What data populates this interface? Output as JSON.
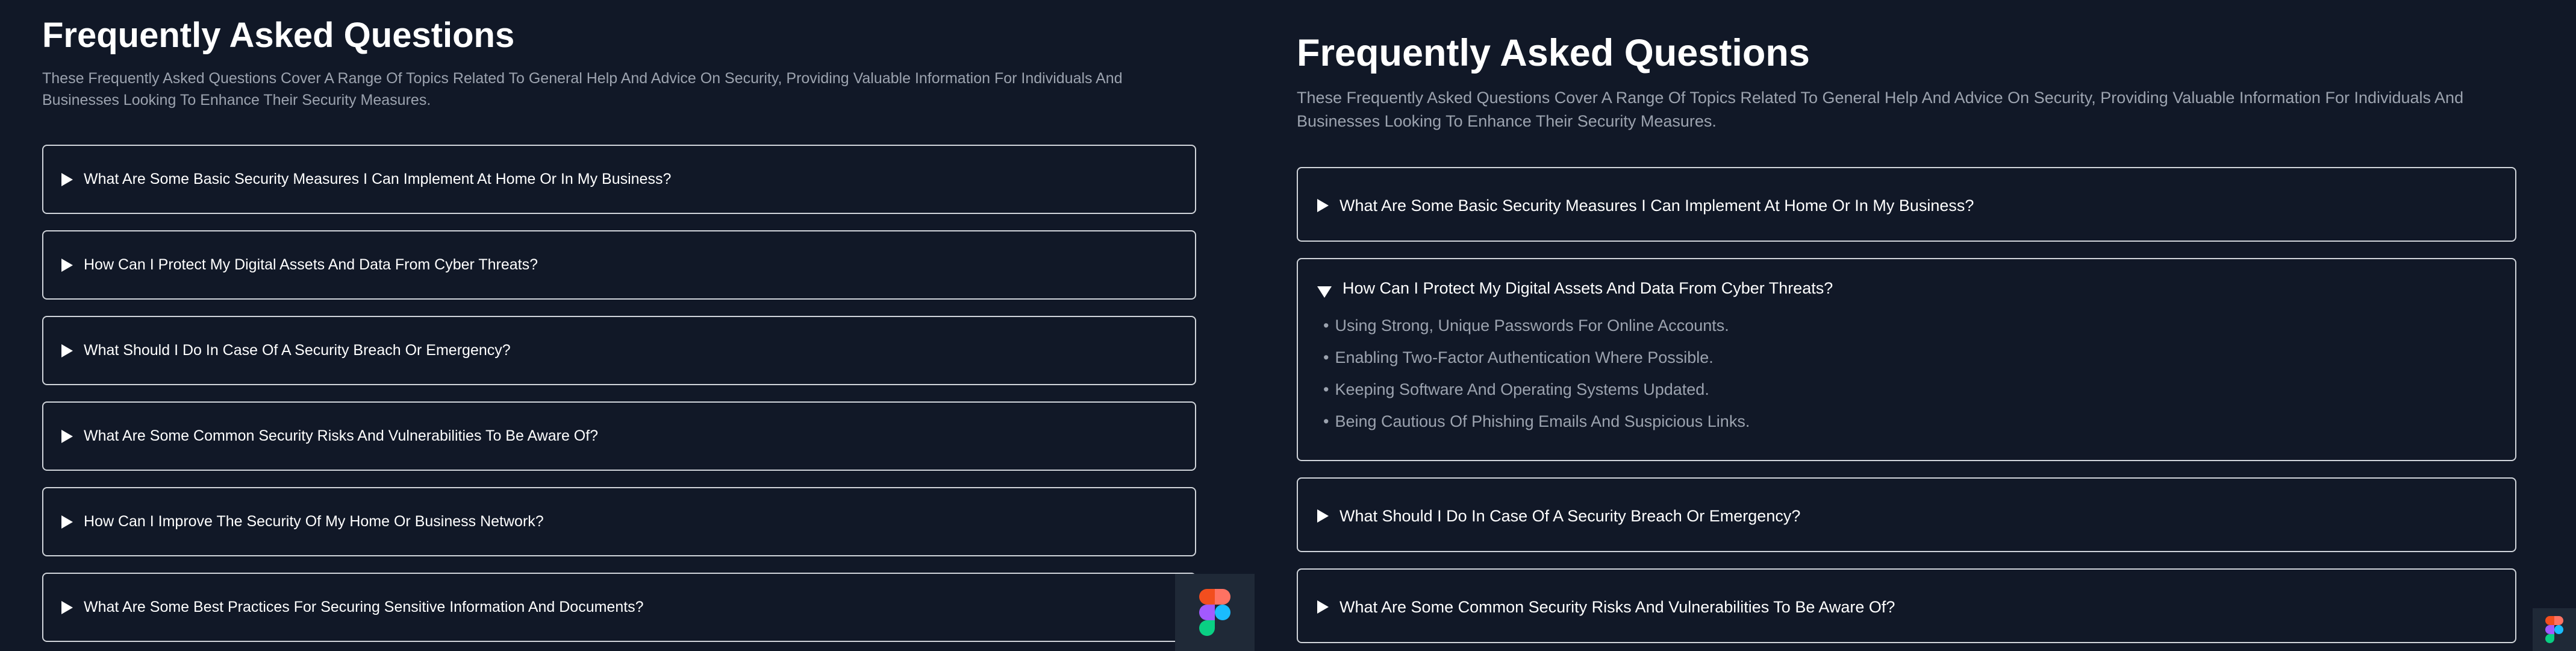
{
  "left": {
    "title": "Frequently Asked Questions",
    "description": "These Frequently Asked Questions Cover A Range Of Topics Related To General Help And Advice On Security, Providing Valuable Information For Individuals And Businesses Looking To Enhance Their Security Measures.",
    "questions": [
      "What Are Some Basic Security Measures I Can Implement At Home Or In My Business?",
      "How Can I Protect My Digital Assets And Data From Cyber Threats?",
      "What Should I Do In Case Of A Security Breach Or Emergency?",
      "What Are Some Common Security Risks And Vulnerabilities To Be Aware Of?",
      "How Can I Improve The Security Of My Home Or Business Network?",
      "What Are Some Best Practices For Securing Sensitive Information And Documents?"
    ]
  },
  "right": {
    "title": "Frequently Asked Questions",
    "description": "These Frequently Asked Questions Cover A Range Of Topics Related To General Help And Advice On Security, Providing Valuable Information For Individuals And Businesses Looking To Enhance Their Security Measures.",
    "questions": [
      "What Are Some Basic Security Measures I Can Implement At Home Or In My Business?",
      "How Can I Protect My Digital Assets And Data From Cyber Threats?",
      "What Should I Do In Case Of A Security Breach Or Emergency?",
      "What Are Some Common Security Risks And Vulnerabilities To Be Aware Of?"
    ],
    "expanded_answers": [
      "Using Strong, Unique Passwords For Online Accounts.",
      "Enabling Two-Factor Authentication Where Possible.",
      "Keeping Software And Operating Systems Updated.",
      "Being Cautious Of Phishing Emails And Suspicious Links."
    ],
    "bullet": "•"
  },
  "icons": {
    "collapsed": "triangle-right-icon",
    "expanded": "triangle-down-icon",
    "badge": "figma-logo-icon"
  },
  "colors": {
    "background": "#111827",
    "border": "#d1d5db",
    "muted_text": "#9ca3af",
    "figma_red": "#f24e1e",
    "figma_orange": "#ff7262",
    "figma_purple": "#a259ff",
    "figma_blue": "#1abcfe",
    "figma_green": "#0acf83"
  }
}
